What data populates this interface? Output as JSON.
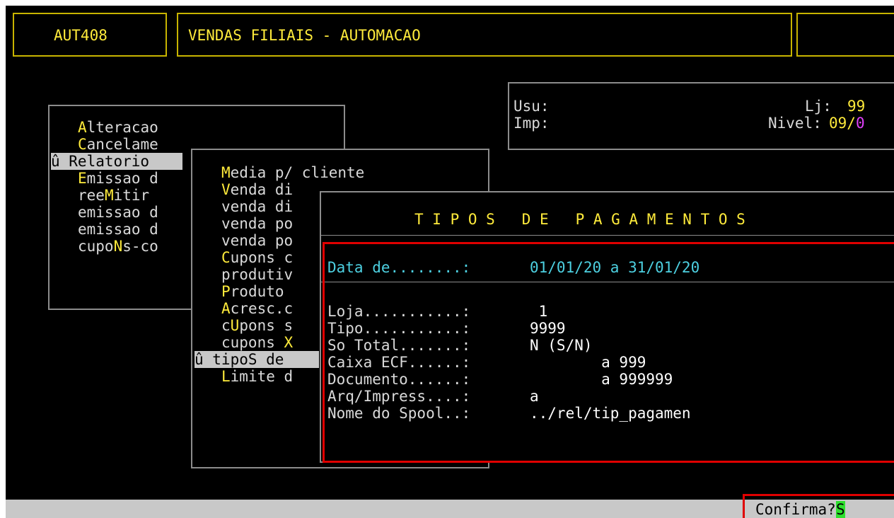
{
  "header": {
    "program_code": "AUT408",
    "program_title": "VENDAS FILIAIS - AUTOMACAO"
  },
  "user_info": {
    "user_label": "Usu:",
    "printer_label": "Imp:",
    "store_label": "Lj:",
    "store_value": "99",
    "level_label": "Nivel:",
    "level_value": "09/0"
  },
  "main_menu": {
    "items": [
      {
        "hot": "A",
        "rest": "lteracao"
      },
      {
        "hot": "C",
        "rest": "ancelame"
      },
      {
        "prefix": "û ",
        "hot": "",
        "rest": "Relatorio"
      },
      {
        "hot": "E",
        "rest": "missao d"
      },
      {
        "pre": "ree",
        "hot": "M",
        "rest": "itir"
      },
      {
        "hot": "",
        "rest": "emissao d"
      },
      {
        "hot": "",
        "rest": "emissao d"
      },
      {
        "pre": "cupo",
        "hot": "N",
        "rest": "s-co"
      }
    ]
  },
  "report_menu": {
    "items": [
      {
        "hot": "M",
        "rest": "edia p/ cliente"
      },
      {
        "hot": "V",
        "rest": "enda di"
      },
      {
        "hot": "",
        "rest": "venda di"
      },
      {
        "hot": "",
        "rest": "venda po"
      },
      {
        "hot": "",
        "rest": "venda po"
      },
      {
        "hot": "C",
        "rest": "upons c"
      },
      {
        "hot": "",
        "rest": "produtiv"
      },
      {
        "hot": "P",
        "rest": "roduto"
      },
      {
        "hot": "A",
        "rest": "cresc.c"
      },
      {
        "pre": "c",
        "hot": "U",
        "rest": "pons s"
      },
      {
        "pre": "cupons ",
        "hot": "X",
        "rest": ""
      },
      {
        "prefix": "û ",
        "hot": "",
        "rest": "tipoS de"
      },
      {
        "hot": "L",
        "rest": "imite d"
      }
    ]
  },
  "dialog": {
    "title": "T I P O S   D E   P A G A M E N T O S",
    "date_label": "Data de........:",
    "date_value": "01/01/20 a 31/01/20",
    "fields": [
      {
        "label": "Loja...........:",
        "value": " 1"
      },
      {
        "label": "Tipo...........:",
        "value": "9999"
      },
      {
        "label": "So Total.......:",
        "value": "N (S/N)"
      },
      {
        "label": "Caixa ECF......:",
        "value": "        a 999"
      },
      {
        "label": "Documento......:",
        "value": "        a 999999"
      },
      {
        "label": "Arq/Impress....:",
        "value": "a"
      },
      {
        "label": "Nome do Spool..:",
        "value": "../rel/tip_pagamen"
      }
    ]
  },
  "status": {
    "confirm_label": "Confirma?",
    "confirm_value": "S"
  },
  "colors": {
    "background": "#000000",
    "hotkey": "#ffeb3b",
    "field_value_cyan": "#4dd0e1",
    "highlight_red": "#e00000",
    "confirm_green": "#2ee02e"
  }
}
